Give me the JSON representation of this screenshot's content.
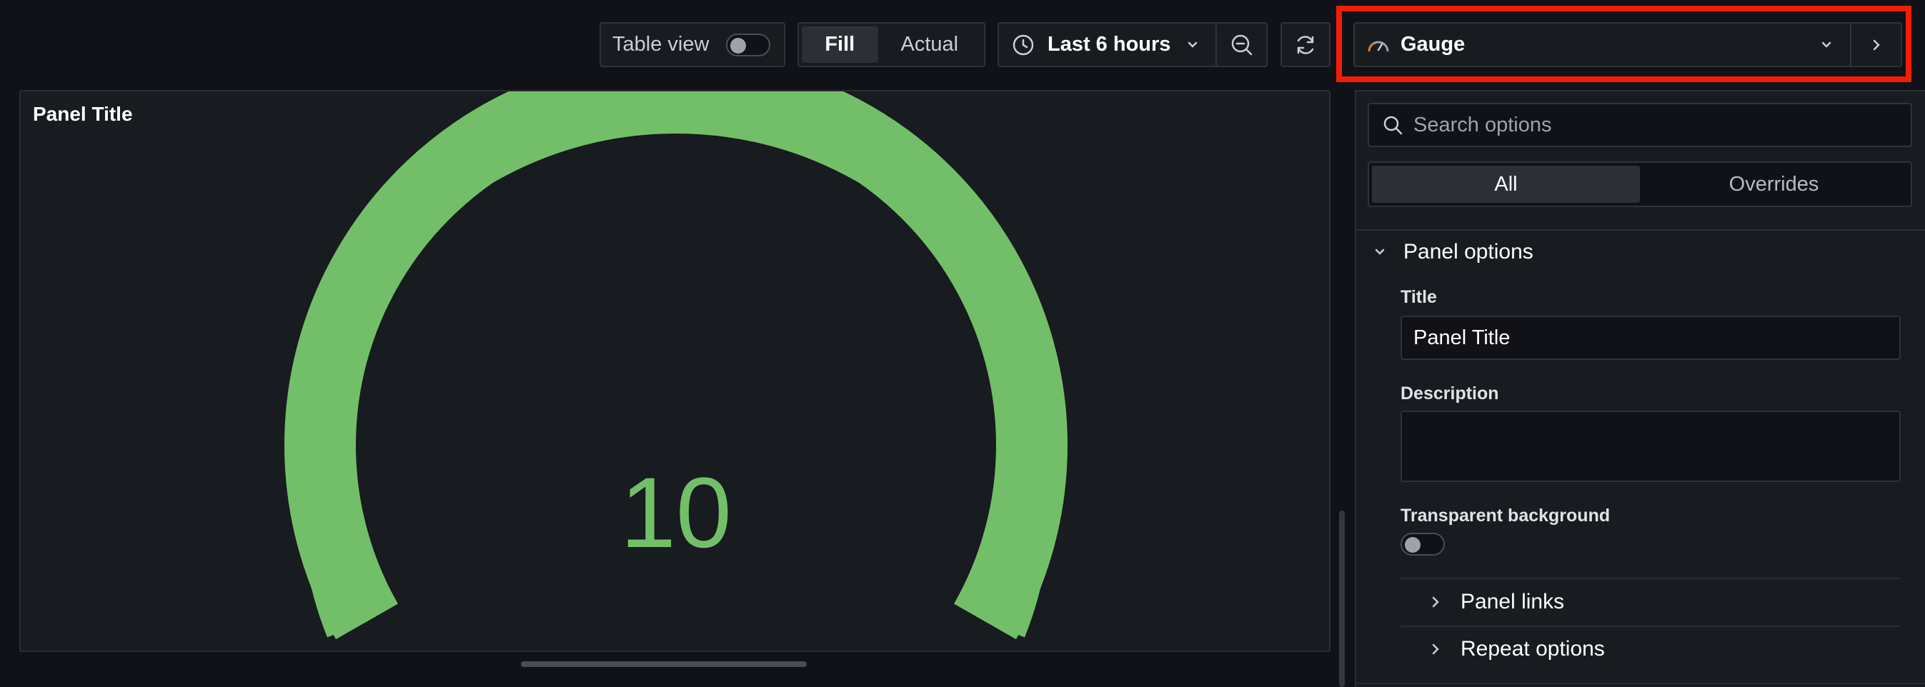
{
  "toolbar": {
    "table_view_label": "Table view",
    "fill_label": "Fill",
    "actual_label": "Actual",
    "time_range_label": "Last 6 hours",
    "visualization_label": "Gauge"
  },
  "panel": {
    "title": "Panel Title",
    "gauge_value": "10",
    "gauge_color": "#73bf69"
  },
  "options": {
    "search_placeholder": "Search options",
    "tab_all": "All",
    "tab_overrides": "Overrides",
    "panel_options_header": "Panel options",
    "title_label": "Title",
    "title_value": "Panel Title",
    "description_label": "Description",
    "description_value": "",
    "transparent_label": "Transparent background",
    "panel_links_label": "Panel links",
    "repeat_options_label": "Repeat options"
  },
  "colors": {
    "background": "#111217",
    "panel_bg": "#181b1f",
    "gauge_green": "#73bf69",
    "highlight_red": "#f21d05"
  }
}
